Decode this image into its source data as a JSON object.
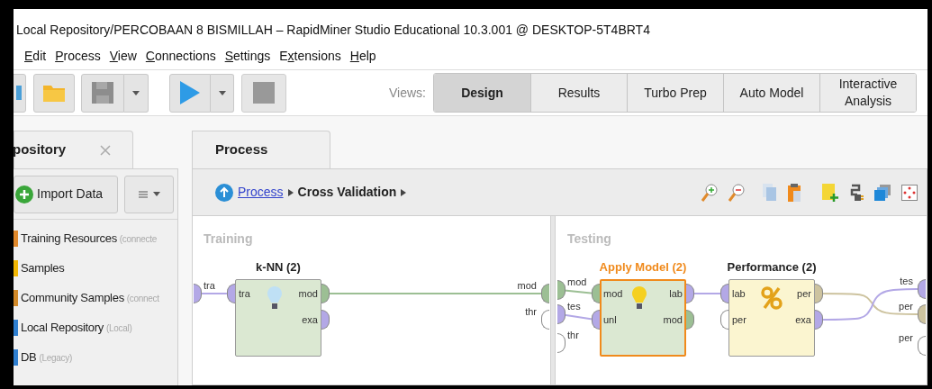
{
  "window": {
    "title": "Local Repository/PERCOBAAN 8 BISMILLAH – RapidMiner Studio Educational 10.3.001 @ DESKTOP-5T4BRT4"
  },
  "menu": [
    {
      "mnemonic": "E",
      "after": "dit"
    },
    {
      "mnemonic": "P",
      "after": "rocess"
    },
    {
      "mnemonic": "V",
      "after": "iew"
    },
    {
      "mnemonic": "C",
      "after": "onnections"
    },
    {
      "mnemonic": "S",
      "after": "ettings"
    },
    {
      "before": "E",
      "mnemonic": "x",
      "after": "tensions"
    },
    {
      "mnemonic": "H",
      "after": "elp"
    }
  ],
  "toolbar": {
    "views_label": "Views:",
    "views": [
      {
        "label": "Design",
        "selected": true
      },
      {
        "label": "Results",
        "selected": false
      },
      {
        "label": "Turbo Prep",
        "selected": false
      },
      {
        "label": "Auto Model",
        "selected": false
      },
      {
        "label": "Interactive Analysis",
        "selected": false
      }
    ]
  },
  "repository": {
    "tab": "pository",
    "import_button": "Import Data",
    "items": [
      {
        "name": "Training Resources",
        "note": "(connecte",
        "color": "#e0892c"
      },
      {
        "name": "Samples",
        "color": "#f2b705"
      },
      {
        "name": "Community Samples",
        "note": "(connect",
        "color": "#d28a2a"
      },
      {
        "name": "Local Repository",
        "note": "(Local)",
        "color": "#2f7fd0"
      },
      {
        "name": "DB",
        "note": "(Legacy)",
        "color": "#2f7fd0"
      }
    ]
  },
  "process": {
    "tab": "Process",
    "breadcrumb": {
      "link": "Process",
      "current": "Cross Validation"
    },
    "subprocesses": [
      {
        "title": "Training",
        "inputs": [
          {
            "label": "tra",
            "color": "#b3a8e6"
          }
        ],
        "outputs": [
          {
            "label": "mod",
            "color": "#9cbf94"
          },
          {
            "label": "thr",
            "color": "#ffffff"
          }
        ],
        "operators": [
          {
            "name": "k-NN (2)",
            "kind": "learner",
            "selected": false,
            "inputs": [
              {
                "label": "tra",
                "color": "#b3a8e6"
              }
            ],
            "outputs": [
              {
                "label": "mod",
                "color": "#9cbf94"
              },
              {
                "label": "exa",
                "color": "#b3a8e6"
              }
            ]
          }
        ]
      },
      {
        "title": "Testing",
        "inputs": [
          {
            "label": "mod",
            "color": "#9cbf94"
          },
          {
            "label": "tes",
            "color": "#b3a8e6"
          },
          {
            "label": "thr",
            "color": "#ffffff"
          }
        ],
        "outputs": [
          {
            "label": "tes",
            "color": "#b3a8e6"
          },
          {
            "label": "per",
            "color": "#cdc39f"
          },
          {
            "label": "per",
            "color": "#ffffff"
          }
        ],
        "operators": [
          {
            "name": "Apply Model (2)",
            "kind": "applier",
            "selected": true,
            "inputs": [
              {
                "label": "mod",
                "color": "#9cbf94"
              },
              {
                "label": "unl",
                "color": "#b3a8e6"
              }
            ],
            "outputs": [
              {
                "label": "lab",
                "color": "#b3a8e6"
              },
              {
                "label": "mod",
                "color": "#9cbf94"
              }
            ]
          },
          {
            "name": "Performance (2)",
            "kind": "performance",
            "selected": false,
            "inputs": [
              {
                "label": "lab",
                "color": "#b3a8e6"
              },
              {
                "label": "per",
                "color": "#ffffff"
              }
            ],
            "outputs": [
              {
                "label": "per",
                "color": "#cdc39f"
              },
              {
                "label": "exa",
                "color": "#b3a8e6"
              }
            ]
          }
        ]
      }
    ]
  }
}
